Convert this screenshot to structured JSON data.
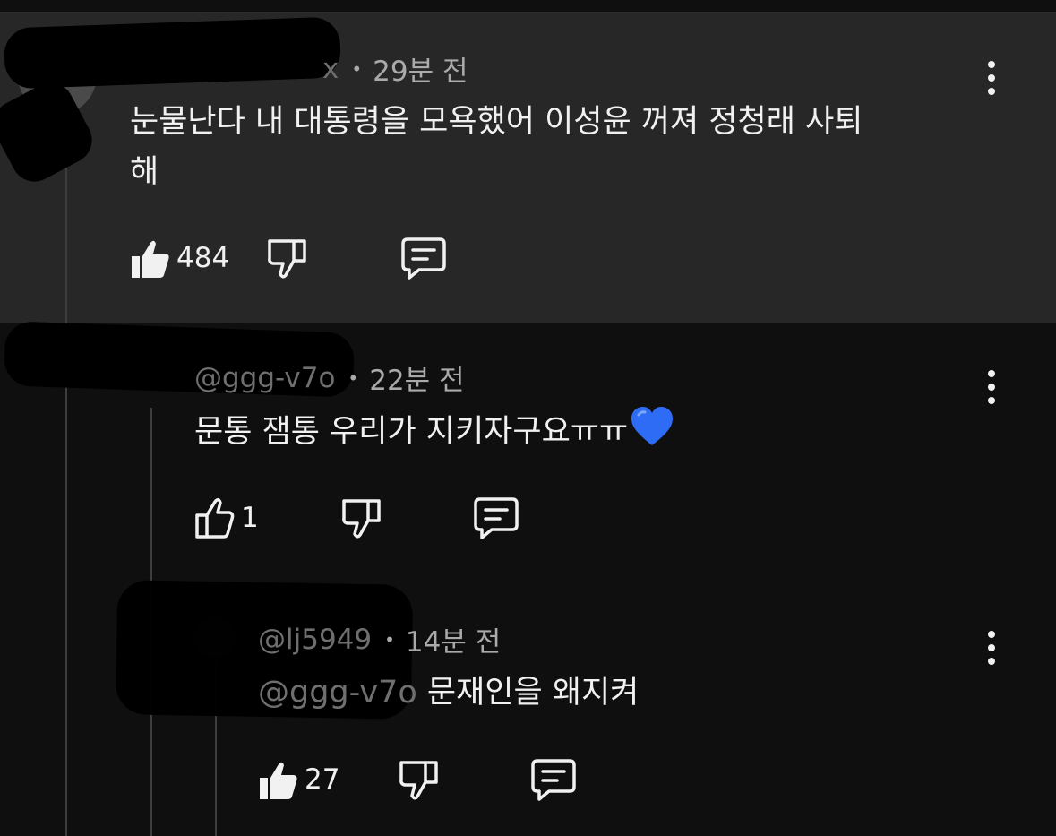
{
  "colors": {
    "background": "#0f0f0f",
    "highlight": "#272727",
    "text": "#f1f1f1",
    "muted": "#aaaaaa",
    "heart": "#2f6cf5"
  },
  "comments": [
    {
      "handle": "x",
      "time": "29분 전",
      "text_line1": "눈물난다 내 대통령을 모욕했어 이성윤 꺼져 정청래 사퇴",
      "text_line2": "해",
      "likes": "484",
      "like_icon": "thumbs-up-filled-icon",
      "dislike_icon": "thumbs-down-icon",
      "reply_icon": "reply-comment-icon",
      "menu_icon": "more-vert-icon"
    },
    {
      "handle": "@ggg-v7o",
      "time": "22분 전",
      "text": "문통 잼통 우리가 지키자구요ㅠㅠ",
      "emoji": "blue-heart-icon",
      "likes": "1",
      "like_icon": "thumbs-up-outline-icon",
      "dislike_icon": "thumbs-down-icon",
      "reply_icon": "reply-comment-icon",
      "menu_icon": "more-vert-icon"
    },
    {
      "handle": "@lj5949",
      "time": "14분 전",
      "mention": "@ggg-v7o",
      "text": " 문재인을 왜지켜",
      "likes": "27",
      "like_icon": "thumbs-up-filled-icon",
      "dislike_icon": "thumbs-down-icon",
      "reply_icon": "reply-comment-icon",
      "menu_icon": "more-vert-icon"
    }
  ]
}
